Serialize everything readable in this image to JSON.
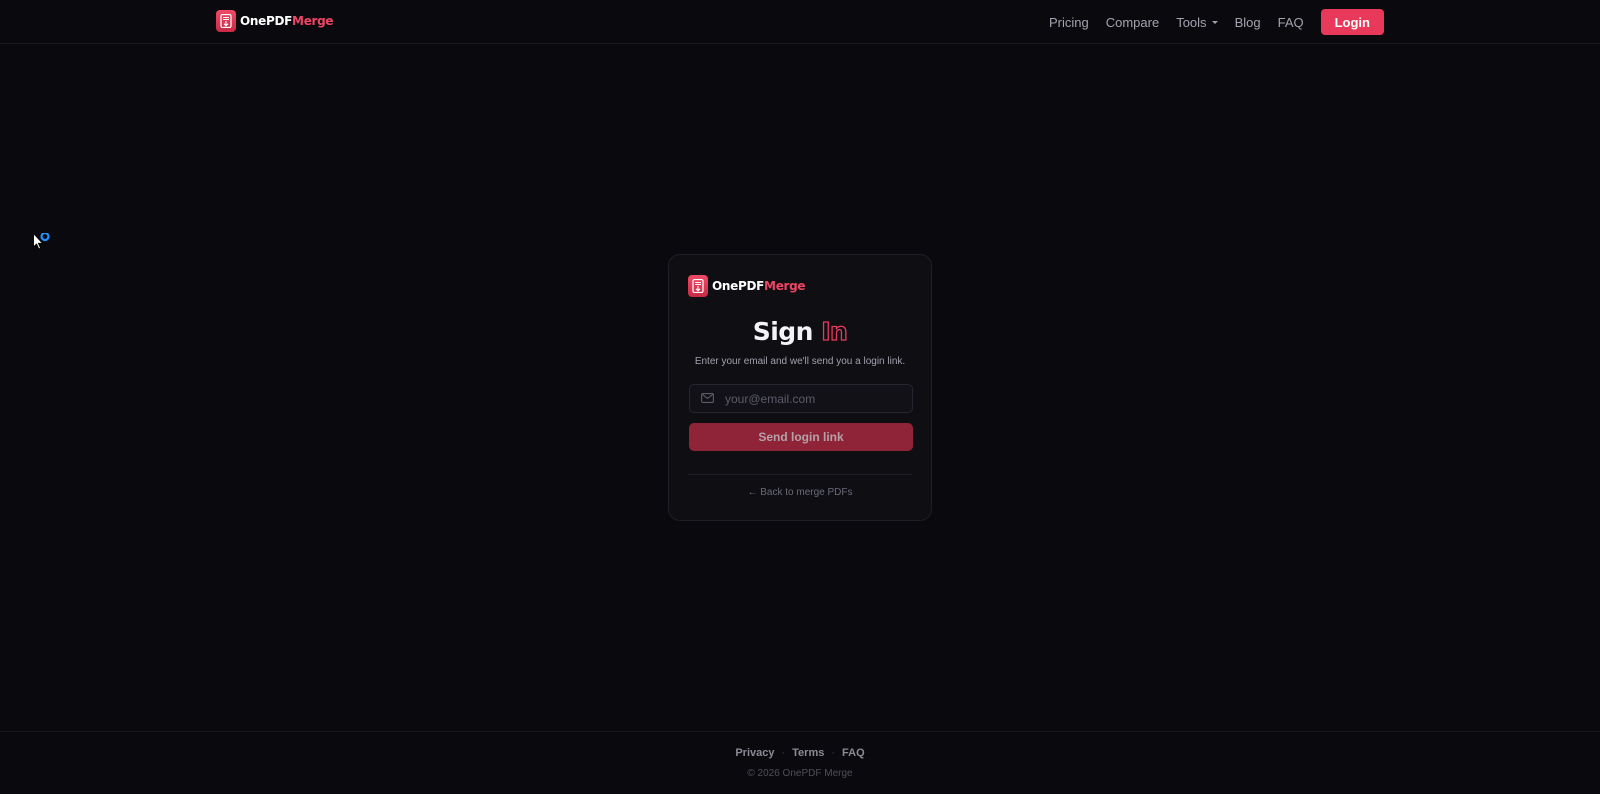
{
  "brand": {
    "name_part1": "OnePDF",
    "name_part2": "Merge",
    "accent_color": "#e9395a",
    "logo_icon": "pdf-merge-icon"
  },
  "nav": {
    "items": [
      {
        "label": "Pricing"
      },
      {
        "label": "Compare"
      },
      {
        "label": "Tools",
        "dropdown": true
      },
      {
        "label": "Blog"
      },
      {
        "label": "FAQ"
      }
    ],
    "login_label": "Login"
  },
  "signin": {
    "title_part1": "Sign",
    "title_part2": "In",
    "subtitle": "Enter your email and we'll send you a login link.",
    "email_placeholder": "your@email.com",
    "email_value": "",
    "email_icon": "mail-icon",
    "submit_label": "Send login link",
    "back_link": "← Back to merge PDFs"
  },
  "footer": {
    "links": [
      {
        "label": "Privacy"
      },
      {
        "label": "Terms"
      },
      {
        "label": "FAQ"
      }
    ],
    "separator": "·",
    "copyright": "© 2026 OnePDF Merge"
  }
}
